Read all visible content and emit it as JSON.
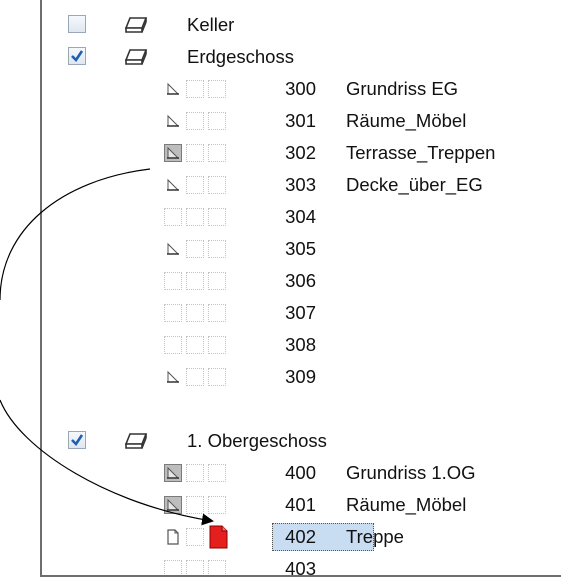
{
  "tree": {
    "groups": [
      {
        "label": "Keller",
        "expanded": false,
        "checked": false
      },
      {
        "label": "Erdgeschoss",
        "expanded": true,
        "checked": true
      },
      {
        "label": "1. Obergeschoss",
        "expanded": true,
        "checked": true
      }
    ],
    "erdgeschoss_items": [
      {
        "number": "300",
        "name": "Grundriss EG",
        "icon": "plan-icon"
      },
      {
        "number": "301",
        "name": "Räume_Möbel",
        "icon": "plan-icon"
      },
      {
        "number": "302",
        "name": "Terrasse_Treppen",
        "icon": "plan-filled-icon"
      },
      {
        "number": "303",
        "name": "Decke_über_EG",
        "icon": "plan-icon"
      },
      {
        "number": "304",
        "name": "",
        "icon": ""
      },
      {
        "number": "305",
        "name": "",
        "icon": "plan-icon"
      },
      {
        "number": "306",
        "name": "",
        "icon": ""
      },
      {
        "number": "307",
        "name": "",
        "icon": ""
      },
      {
        "number": "308",
        "name": "",
        "icon": ""
      },
      {
        "number": "309",
        "name": "",
        "icon": "plan-icon"
      }
    ],
    "obergeschoss_items": [
      {
        "number": "400",
        "name": "Grundriss 1.OG",
        "icon": "plan-filled-icon"
      },
      {
        "number": "401",
        "name": "Räume_Möbel",
        "icon": "plan-filled-icon"
      },
      {
        "number": "402",
        "name": "Treppe",
        "icon": "document-icon",
        "selected": true
      },
      {
        "number": "403",
        "name": "",
        "icon": ""
      }
    ]
  },
  "colors": {
    "selection": "#c8dcf2",
    "checkmark": "#1e5fb4",
    "red_sheet": "#e51e1e"
  }
}
